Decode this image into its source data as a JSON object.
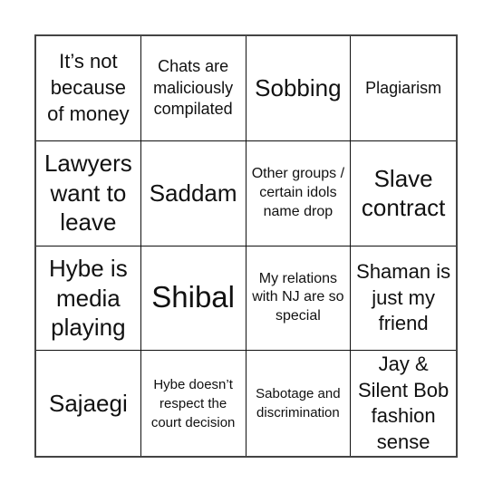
{
  "board": {
    "cells": [
      {
        "text": "It’s not because of money",
        "size": "s-m"
      },
      {
        "text": "Chats are maliciously compilated",
        "size": "s-s"
      },
      {
        "text": "Sobbing",
        "size": "s-l"
      },
      {
        "text": "Plagiarism",
        "size": "s-s"
      },
      {
        "text": "Lawyers want to leave",
        "size": "s-l"
      },
      {
        "text": "Saddam",
        "size": "s-l"
      },
      {
        "text": "Other groups / certain idols name drop",
        "size": "s-xs"
      },
      {
        "text": "Slave contract",
        "size": "s-l"
      },
      {
        "text": "Hybe is media playing",
        "size": "s-l"
      },
      {
        "text": "Shibal",
        "size": "s-xl"
      },
      {
        "text": "My relations with NJ are so special",
        "size": "s-xs"
      },
      {
        "text": "Shaman is just my friend",
        "size": "s-m"
      },
      {
        "text": "Sajaegi",
        "size": "s-l"
      },
      {
        "text": "Hybe doesn’t respect the court decision",
        "size": "s-xxs"
      },
      {
        "text": "Sabotage and discrimination",
        "size": "s-xxs"
      },
      {
        "text": "Jay & Silent Bob fashion sense",
        "size": "s-m"
      }
    ]
  }
}
